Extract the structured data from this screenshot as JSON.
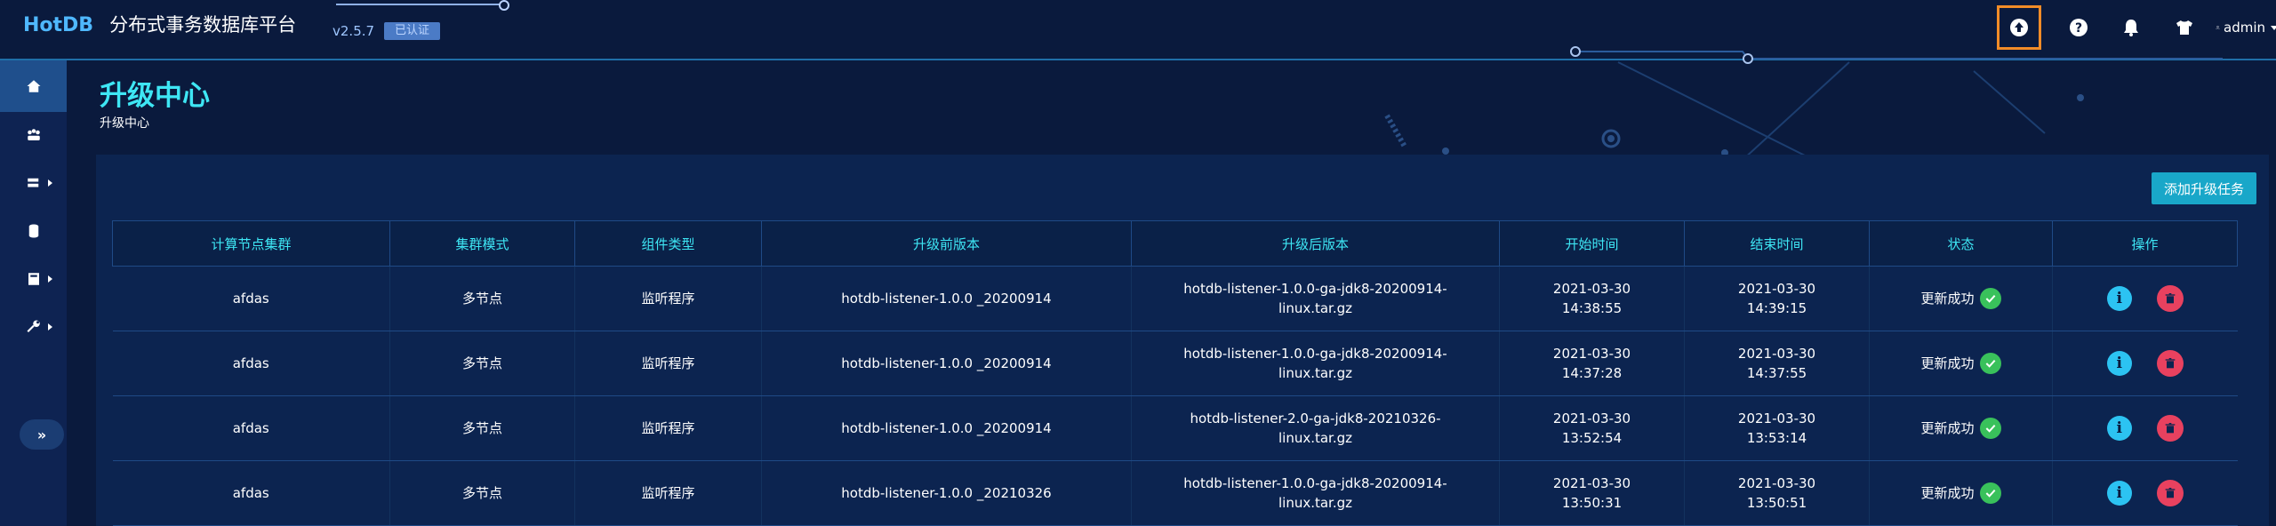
{
  "header": {
    "logo": "HotDB",
    "app_name": "分布式事务数据库平台",
    "version": "v2.5.7",
    "cert_badge": "已认证",
    "user": "admin",
    "icons": [
      "upgrade-icon",
      "help-icon",
      "bell-icon",
      "tshirt-icon",
      "user-icon"
    ]
  },
  "sidebar": {
    "items": [
      "home-icon",
      "cluster-icon",
      "server-icon",
      "database-icon",
      "report-icon",
      "tools-icon"
    ],
    "expand_label": "»"
  },
  "page": {
    "title": "升级中心",
    "breadcrumb": "升级中心",
    "add_button": "添加升级任务"
  },
  "table": {
    "headers": [
      "计算节点集群",
      "集群模式",
      "组件类型",
      "升级前版本",
      "升级后版本",
      "开始时间",
      "结束时间",
      "状态",
      "操作"
    ],
    "rows": [
      {
        "cluster": "afdas",
        "mode": "多节点",
        "type": "监听程序",
        "before": "hotdb-listener-1.0.0 _20200914",
        "after1": "hotdb-listener-1.0.0-ga-jdk8-20200914-",
        "after2": "linux.tar.gz",
        "start1": "2021-03-30",
        "start2": "14:38:55",
        "end1": "2021-03-30",
        "end2": "14:39:15",
        "status": "更新成功"
      },
      {
        "cluster": "afdas",
        "mode": "多节点",
        "type": "监听程序",
        "before": "hotdb-listener-1.0.0 _20200914",
        "after1": "hotdb-listener-1.0.0-ga-jdk8-20200914-",
        "after2": "linux.tar.gz",
        "start1": "2021-03-30",
        "start2": "14:37:28",
        "end1": "2021-03-30",
        "end2": "14:37:55",
        "status": "更新成功"
      },
      {
        "cluster": "afdas",
        "mode": "多节点",
        "type": "监听程序",
        "before": "hotdb-listener-1.0.0 _20200914",
        "after1": "hotdb-listener-2.0-ga-jdk8-20210326-",
        "after2": "linux.tar.gz",
        "start1": "2021-03-30",
        "start2": "13:52:54",
        "end1": "2021-03-30",
        "end2": "13:53:14",
        "status": "更新成功"
      },
      {
        "cluster": "afdas",
        "mode": "多节点",
        "type": "监听程序",
        "before": "hotdb-listener-1.0.0 _20210326",
        "after1": "hotdb-listener-1.0.0-ga-jdk8-20200914-",
        "after2": "linux.tar.gz",
        "start1": "2021-03-30",
        "start2": "13:50:31",
        "end1": "2021-03-30",
        "end2": "13:50:51",
        "status": "更新成功"
      }
    ]
  },
  "colors": {
    "accent": "#3ee6f4",
    "background": "#0a1a3d",
    "panel": "#0c2450",
    "success": "#39c15b",
    "danger": "#e8415f",
    "info": "#2cc3f2",
    "highlight": "#f28c28"
  }
}
